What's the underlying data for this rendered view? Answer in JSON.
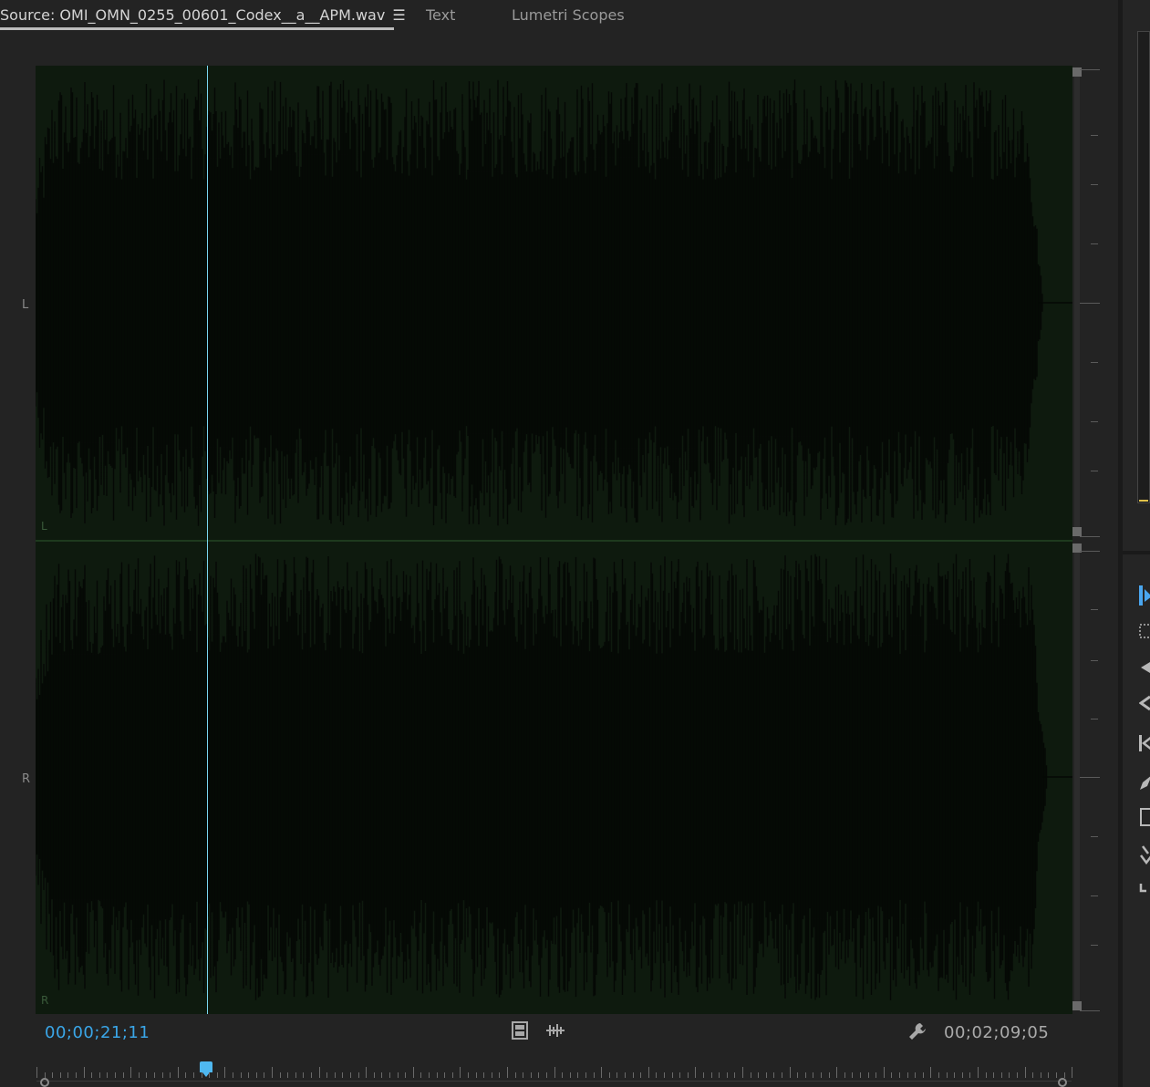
{
  "tabs": [
    {
      "label": "Source: OMI_OMN_0255_00601_Codex__a__APM.wav",
      "active": true
    },
    {
      "label": "Text",
      "active": false
    },
    {
      "label": "Lumetri Scopes",
      "active": false
    }
  ],
  "tab_menu_icon": "hamburger-menu-icon",
  "channels": {
    "left_label": "L",
    "right_label": "R"
  },
  "timecode": {
    "current": "00;00;21;11",
    "duration": "00;02;09;05"
  },
  "controls": {
    "drag_video_icon": "film-strip-icon",
    "drag_audio_icon": "audio-waveform-icon",
    "settings_icon": "wrench-icon"
  },
  "colors": {
    "waveform_bg": "#0e1a0e",
    "playhead": "#7ad7f0",
    "timecode_current": "#3aa6e8",
    "accent_blue": "#4fb8f0"
  },
  "tools": [
    {
      "icon": "selection-tool-icon",
      "active": true
    },
    {
      "icon": "track-select-tool-icon",
      "active": false
    },
    {
      "icon": "ripple-edit-tool-icon",
      "active": false
    },
    {
      "icon": "rolling-edit-tool-icon",
      "active": false
    },
    {
      "icon": "razor-tool-icon",
      "active": false
    },
    {
      "icon": "pen-tool-icon",
      "active": false
    },
    {
      "icon": "rectangle-tool-icon",
      "active": false
    },
    {
      "icon": "hand-tool-icon",
      "active": false
    },
    {
      "icon": "type-tool-icon",
      "active": false
    }
  ]
}
